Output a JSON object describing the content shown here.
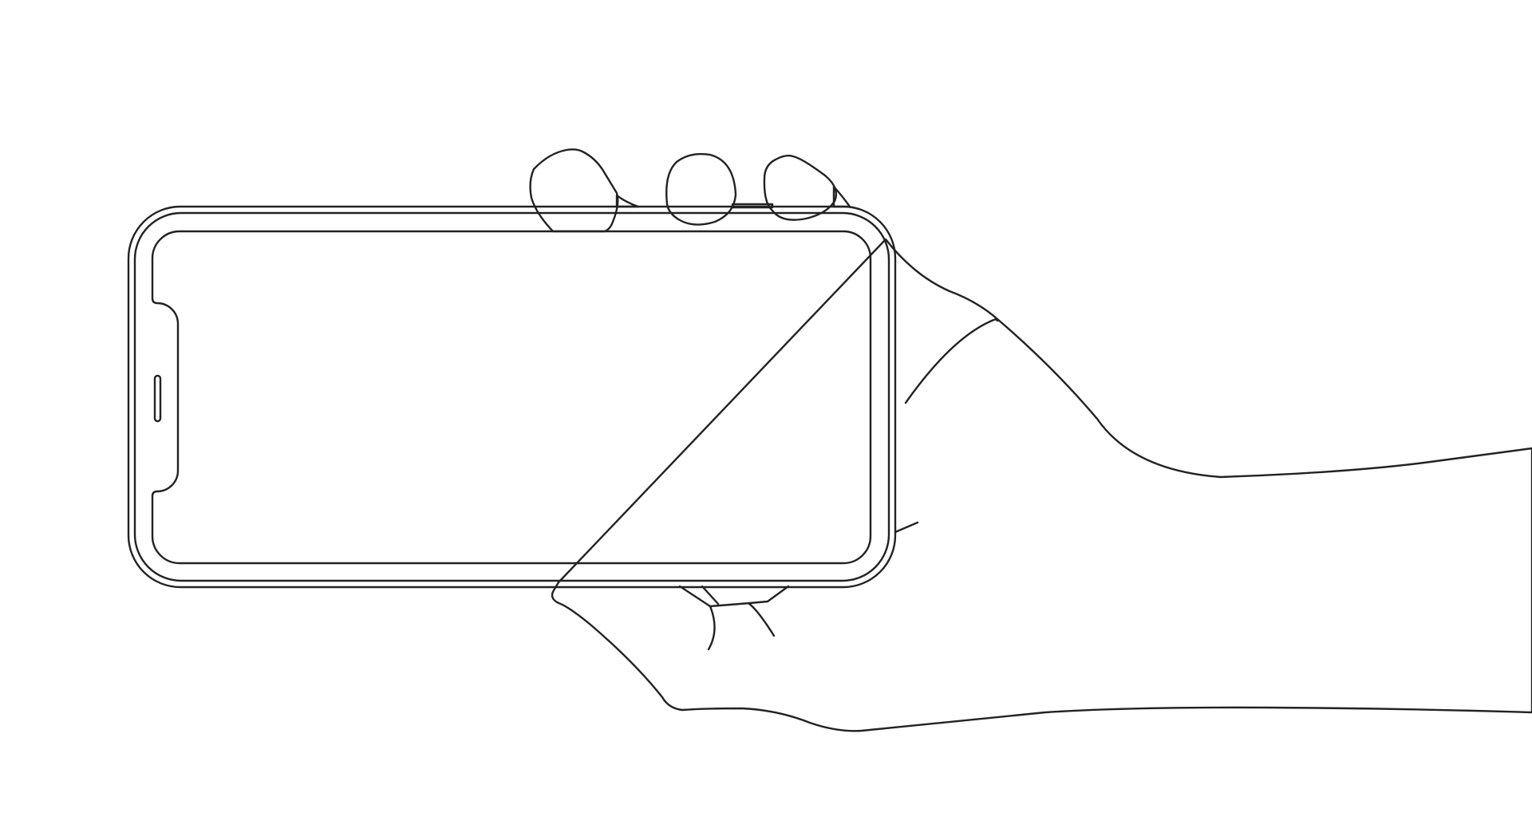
{
  "illustration": {
    "subject_icon": "hand-holding-phone-landscape-icon",
    "colors": {
      "background": "#ffffff",
      "fill": "#e4e4e4",
      "outline": "#222222",
      "screen": "#ffffff"
    },
    "phone": {
      "orientation": "landscape",
      "screen_state": "blank"
    }
  }
}
